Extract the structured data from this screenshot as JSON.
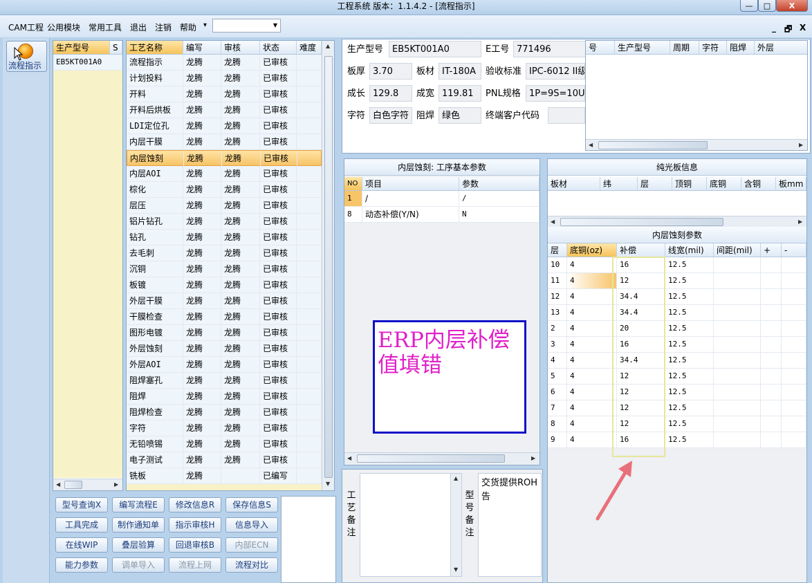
{
  "window": {
    "title": "工程系统   版本：1.1.4.2 - [流程指示]",
    "min": "—",
    "max": "□",
    "close": "X"
  },
  "menu": {
    "items": [
      "CAM工程",
      "公用模块",
      "常用工具",
      "退出",
      "注销",
      "帮助"
    ],
    "help_arrow": "▾",
    "mdi": [
      "_",
      "🗗",
      "X"
    ]
  },
  "toolbar": {
    "flow_label": "流程指示"
  },
  "models": {
    "headers": [
      "生产型号",
      "S"
    ],
    "rows": [
      "EB5KT001A0"
    ]
  },
  "processes": {
    "headers": [
      "工艺名称",
      "编写",
      "审核",
      "状态",
      "难度"
    ],
    "rows": [
      [
        "流程指示",
        "龙腾",
        "龙腾",
        "已审核"
      ],
      [
        "计划投料",
        "龙腾",
        "龙腾",
        "已审核"
      ],
      [
        "开料",
        "龙腾",
        "龙腾",
        "已审核"
      ],
      [
        "开料后烘板",
        "龙腾",
        "龙腾",
        "已审核"
      ],
      [
        "LDI定位孔",
        "龙腾",
        "龙腾",
        "已审核"
      ],
      [
        "内层干膜",
        "龙腾",
        "龙腾",
        "已审核"
      ],
      [
        "内层蚀刻",
        "龙腾",
        "龙腾",
        "已审核"
      ],
      [
        "内层AOI",
        "龙腾",
        "龙腾",
        "已审核"
      ],
      [
        "棕化",
        "龙腾",
        "龙腾",
        "已审核"
      ],
      [
        "层压",
        "龙腾",
        "龙腾",
        "已审核"
      ],
      [
        "铝片钻孔",
        "龙腾",
        "龙腾",
        "已审核"
      ],
      [
        "钻孔",
        "龙腾",
        "龙腾",
        "已审核"
      ],
      [
        "去毛刺",
        "龙腾",
        "龙腾",
        "已审核"
      ],
      [
        "沉铜",
        "龙腾",
        "龙腾",
        "已审核"
      ],
      [
        "板镀",
        "龙腾",
        "龙腾",
        "已审核"
      ],
      [
        "外层干膜",
        "龙腾",
        "龙腾",
        "已审核"
      ],
      [
        "干膜检查",
        "龙腾",
        "龙腾",
        "已审核"
      ],
      [
        "图形电镀",
        "龙腾",
        "龙腾",
        "已审核"
      ],
      [
        "外层蚀刻",
        "龙腾",
        "龙腾",
        "已审核"
      ],
      [
        "外层AOI",
        "龙腾",
        "龙腾",
        "已审核"
      ],
      [
        "阻焊塞孔",
        "龙腾",
        "龙腾",
        "已审核"
      ],
      [
        "阻焊",
        "龙腾",
        "龙腾",
        "已审核"
      ],
      [
        "阻焊检查",
        "龙腾",
        "龙腾",
        "已审核"
      ],
      [
        "字符",
        "龙腾",
        "龙腾",
        "已审核"
      ],
      [
        "无铅喷锡",
        "龙腾",
        "龙腾",
        "已审核"
      ],
      [
        "电子测试",
        "龙腾",
        "龙腾",
        "已审核"
      ],
      [
        "铣板",
        "龙腾",
        "",
        "已编写"
      ]
    ],
    "selected": 6
  },
  "buttons": [
    [
      "型号查询X",
      "编写流程E",
      "修改信息R",
      "保存信息S"
    ],
    [
      "工具完成",
      "制作通知单",
      "指示审核H",
      "信息导入"
    ],
    [
      "在线WIP",
      "叠层验算",
      "回退审核B",
      "内部ECN"
    ],
    [
      "能力参数",
      "调单导入",
      "流程上网",
      "流程对比"
    ]
  ],
  "buttons_disabled": [
    "内部ECN",
    "调单导入",
    "流程上网"
  ],
  "info": {
    "model_label": "生产型号",
    "model": "EB5KT001A0",
    "job_label": "E工号",
    "job": "771496",
    "thick_label": "板厚",
    "thick": "3.70",
    "mat_label": "板材",
    "mat": "IT-180A",
    "std_label": "验收标准",
    "std": "IPC-6012 II级",
    "len_label": "成长",
    "len": "129.8",
    "wid_label": "成宽",
    "wid": "119.81",
    "pnl_label": "PNL规格",
    "pnl": "1P=9S=10U",
    "char_label": "字符",
    "char": "白色字符",
    "mask_label": "阻焊",
    "mask": "绿色",
    "cust_label": "终端客户代码",
    "cust": ""
  },
  "history": {
    "headers": [
      "号",
      "生产型号",
      "周期",
      "字符",
      "阻焊",
      "外层"
    ]
  },
  "basic": {
    "title": "内层蚀刻: 工序基本参数",
    "headers": [
      "NO",
      "项目",
      "参数"
    ],
    "rows": [
      [
        "1",
        "/",
        "/"
      ],
      [
        "8",
        "动态补偿(Y/N)",
        "N"
      ]
    ]
  },
  "annotation": {
    "text": "ERP内层补偿值填错"
  },
  "bare": {
    "title": "纯光板信息",
    "headers": [
      "板材",
      "纬",
      "层",
      "顶铜",
      "底铜",
      "含铜",
      "板mm"
    ]
  },
  "etch": {
    "title": "内层蚀刻参数",
    "headers": [
      "层",
      "底铜(oz)",
      "补偿",
      "线宽(mil)",
      "间距(mil)",
      "+",
      "-"
    ],
    "rows": [
      [
        "10",
        "4",
        "16",
        "12.5"
      ],
      [
        "11",
        "4",
        "12",
        "12.5"
      ],
      [
        "12",
        "4",
        "34.4",
        "12.5"
      ],
      [
        "13",
        "4",
        "34.4",
        "12.5"
      ],
      [
        "2",
        "4",
        "20",
        "12.5"
      ],
      [
        "3",
        "4",
        "16",
        "12.5"
      ],
      [
        "4",
        "4",
        "34.4",
        "12.5"
      ],
      [
        "5",
        "4",
        "12",
        "12.5"
      ],
      [
        "6",
        "4",
        "12",
        "12.5"
      ],
      [
        "7",
        "4",
        "12",
        "12.5"
      ],
      [
        "8",
        "4",
        "12",
        "12.5"
      ],
      [
        "9",
        "4",
        "16",
        "12.5"
      ]
    ]
  },
  "notes": {
    "process_label": "工艺备注",
    "model_label": "型号备注",
    "model_text": "交货提供ROH告"
  },
  "colors": {
    "annotation_border": "#1010c8",
    "annotation_text": "#e020c8",
    "highlight": "#f0f0a0",
    "arrow": "#e8707a",
    "selected": "#f7c468"
  }
}
